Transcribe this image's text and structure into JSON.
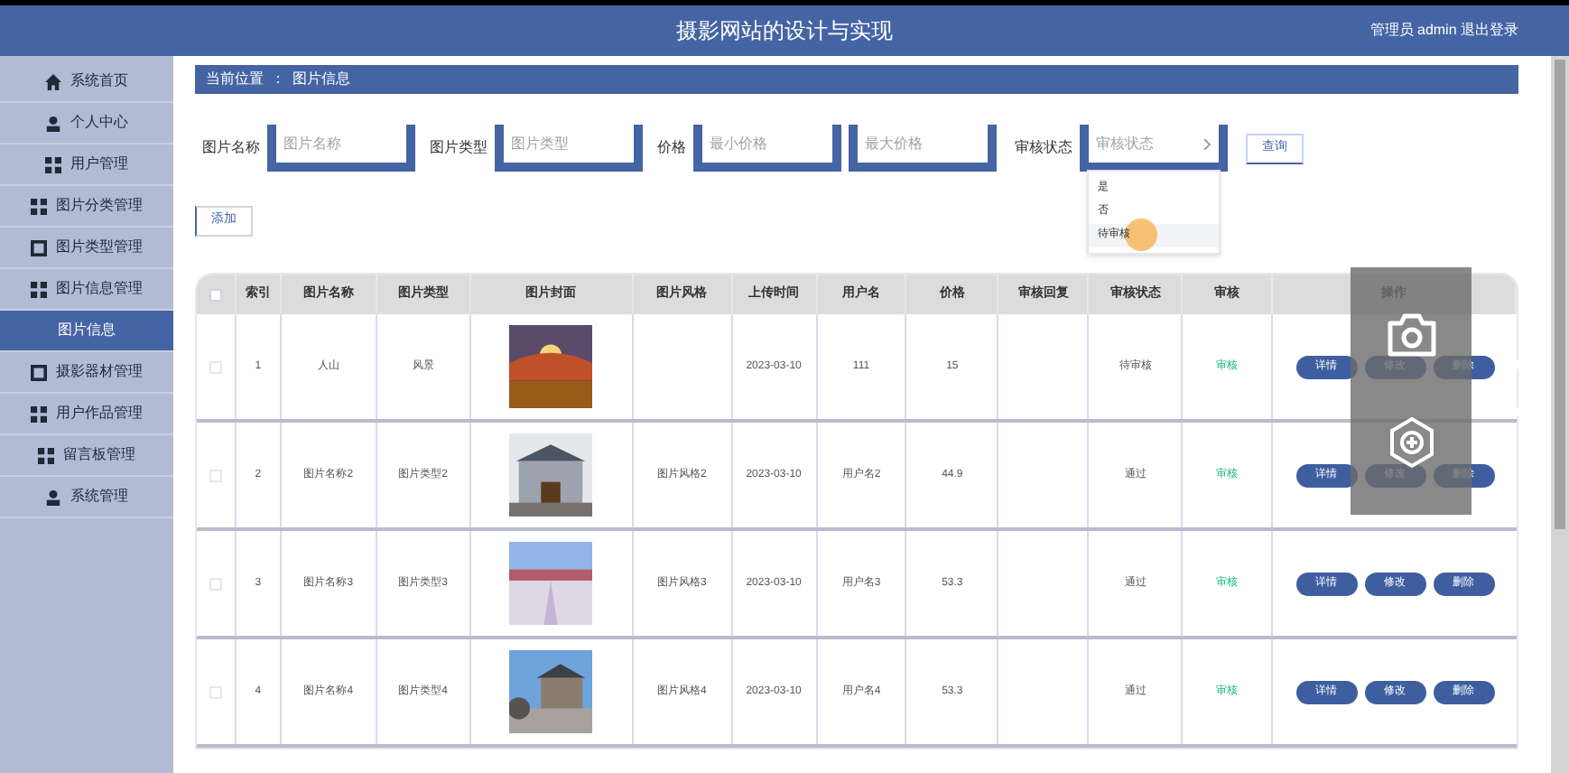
{
  "header": {
    "title": "摄影网站的设计与实现",
    "user_info": "管理员 admin 退出登录"
  },
  "sidebar": {
    "items": [
      {
        "label": "系统首页",
        "kind": "home",
        "selected": false
      },
      {
        "label": "个人中心",
        "kind": "user",
        "selected": false
      },
      {
        "label": "用户管理",
        "kind": "grid",
        "selected": false
      },
      {
        "label": "图片分类管理",
        "kind": "grid",
        "selected": false
      },
      {
        "label": "图片类型管理",
        "kind": "square",
        "selected": false
      },
      {
        "label": "图片信息管理",
        "kind": "grid",
        "selected": false
      },
      {
        "label": "图片信息",
        "kind": "sub",
        "selected": true
      },
      {
        "label": "摄影器材管理",
        "kind": "square",
        "selected": false
      },
      {
        "label": "用户作品管理",
        "kind": "grid",
        "selected": false
      },
      {
        "label": "留言板管理",
        "kind": "grid",
        "selected": false
      },
      {
        "label": "系统管理",
        "kind": "user",
        "selected": false
      }
    ]
  },
  "breadcrumb": {
    "home": "当前位置",
    "separator": "：",
    "current": "图片信息"
  },
  "search": {
    "fields": [
      {
        "label": "图片名称",
        "placeholder": "图片名称"
      },
      {
        "label": "图片类型",
        "placeholder": "图片类型"
      },
      {
        "label": "价格",
        "placeholder": "最小价格"
      },
      {
        "placeholder": "最大价格"
      }
    ],
    "status": {
      "label": "审核状态",
      "placeholder": "审核状态",
      "options": [
        {
          "label": "是",
          "hovered": false
        },
        {
          "label": "否",
          "hovered": false
        },
        {
          "label": "待审核",
          "hovered": true
        }
      ]
    },
    "button": "查询"
  },
  "add_button": "添加",
  "table": {
    "select_all": {
      "checked": false
    },
    "columns": [
      "索引",
      "图片名称",
      "图片类型",
      "图片封面",
      "图片风格",
      "上传时间",
      "用户名",
      "价格",
      "审核回复",
      "审核状态",
      "审核",
      "操作"
    ],
    "rows": [
      {
        "checked": false,
        "index": "1",
        "name": "人山",
        "type": "风景",
        "time": "2023-03-10",
        "user": "111",
        "price": "15",
        "status": "待审核",
        "review": "审核",
        "actions": [
          "详情",
          "修改",
          "删除"
        ]
      },
      {
        "checked": false,
        "index": "2",
        "name": "图片名称2",
        "type": "图片类型2",
        "style": "图片风格2",
        "time": "2023-03-10",
        "user": "用户名2",
        "price": "44.9",
        "status": "通过",
        "review": "审核",
        "actions": [
          "详情",
          "修改",
          "删除"
        ]
      },
      {
        "checked": false,
        "index": "3",
        "name": "图片名称3",
        "type": "图片类型3",
        "style": "图片风格3",
        "time": "2023-03-10",
        "user": "用户名3",
        "price": "53.3",
        "status": "通过",
        "review": "审核",
        "actions": [
          "详情",
          "修改",
          "删除"
        ]
      },
      {
        "checked": false,
        "index": "4",
        "name": "图片名称4",
        "type": "图片类型4",
        "style": "图片风格4",
        "time": "2023-03-10",
        "user": "用户名4",
        "price": "53.3",
        "status": "通过",
        "review": "审核",
        "actions": [
          "详情",
          "修改",
          "删除"
        ]
      }
    ]
  }
}
